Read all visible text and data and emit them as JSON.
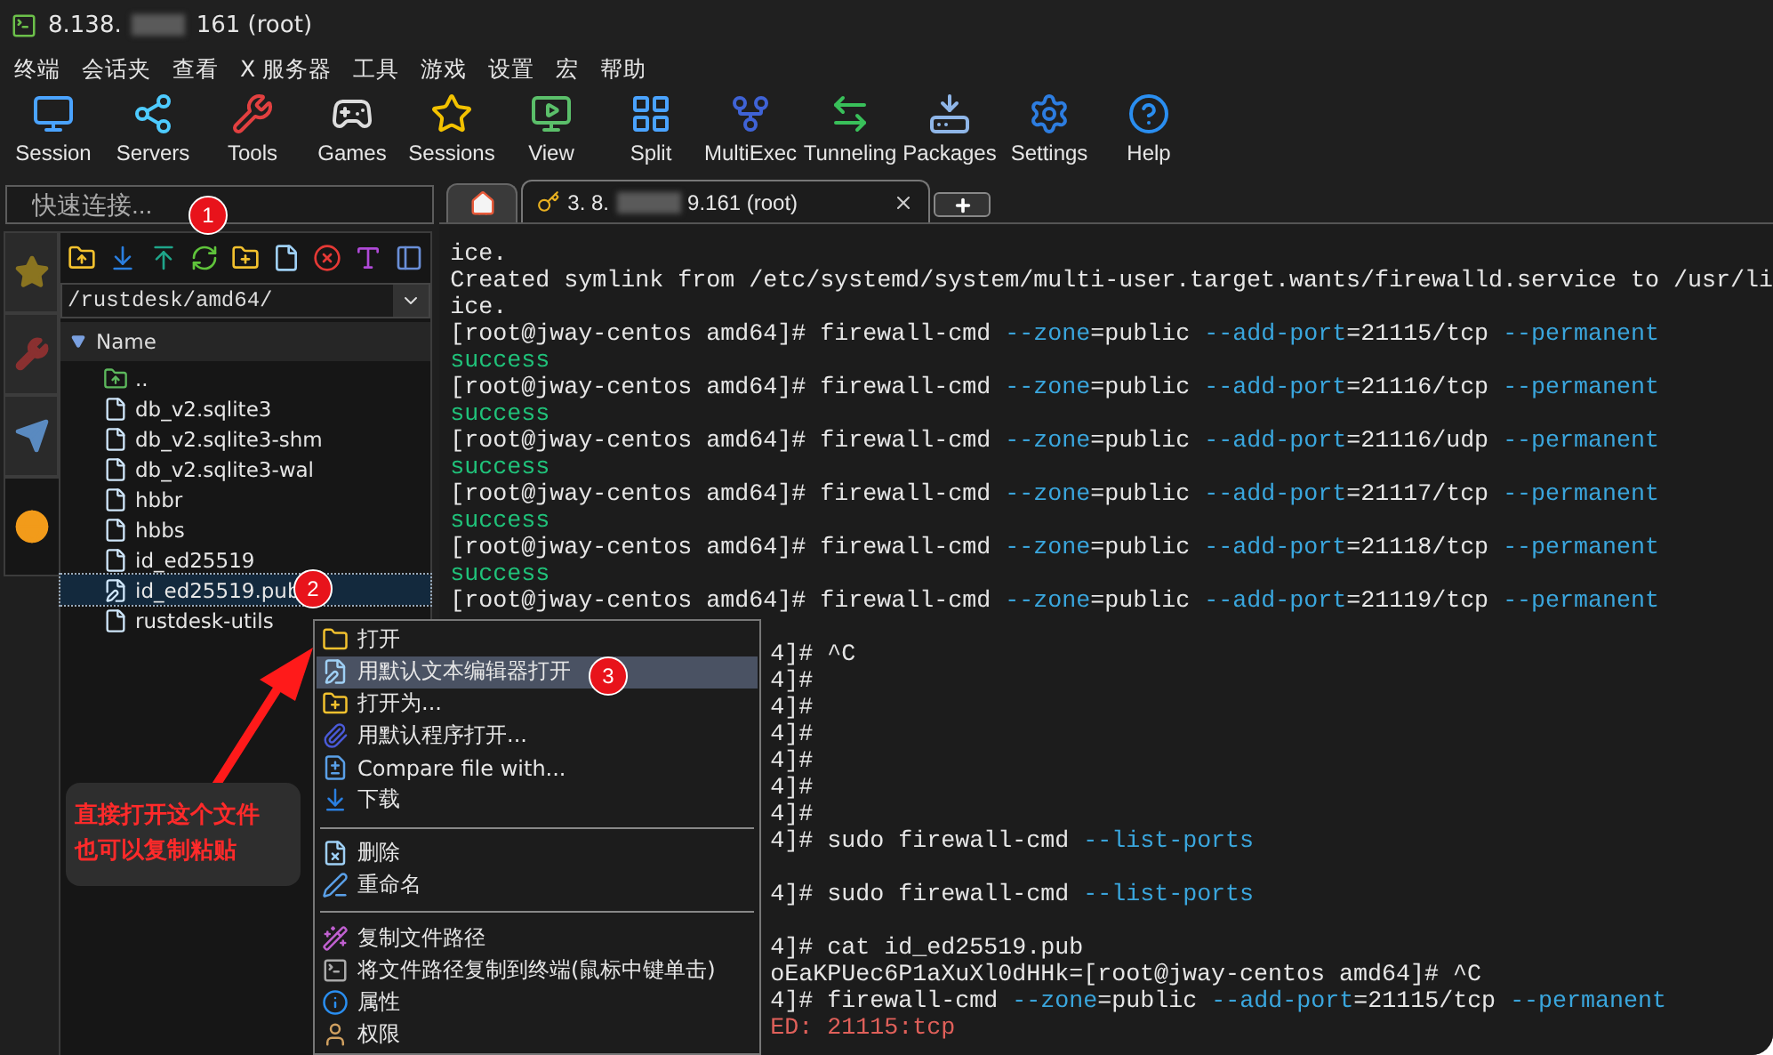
{
  "window": {
    "title_parts": [
      "8.138.",
      "161 (root)"
    ]
  },
  "menu": [
    "终端",
    "会话夹",
    "查看",
    "X 服务器",
    "工具",
    "游戏",
    "设置",
    "宏",
    "帮助"
  ],
  "toolbar": [
    "Session",
    "Servers",
    "Tools",
    "Games",
    "Sessions",
    "View",
    "Split",
    "MultiExec",
    "Tunneling",
    "Packages",
    "Settings",
    "Help"
  ],
  "quick_connect": {
    "placeholder": "快速连接..."
  },
  "side_tabs": [
    {
      "selected": false
    },
    {
      "selected": false
    },
    {
      "selected": false
    },
    {
      "selected": true
    }
  ],
  "file_browser": {
    "path": "/rustdesk/amd64/",
    "column": "Name",
    "files": [
      {
        "name": "..",
        "kind": "parent",
        "selected": false
      },
      {
        "name": "db_v2.sqlite3",
        "kind": "file",
        "selected": false
      },
      {
        "name": "db_v2.sqlite3-shm",
        "kind": "file",
        "selected": false
      },
      {
        "name": "db_v2.sqlite3-wal",
        "kind": "file",
        "selected": false
      },
      {
        "name": "hbbr",
        "kind": "file",
        "selected": false
      },
      {
        "name": "hbbs",
        "kind": "file",
        "selected": false
      },
      {
        "name": "id_ed25519",
        "kind": "file",
        "selected": false
      },
      {
        "name": "id_ed25519.pub",
        "kind": "text",
        "selected": true
      },
      {
        "name": "rustdesk-utils",
        "kind": "file",
        "selected": false
      }
    ]
  },
  "session_tab": {
    "label_parts": [
      "3. 8.",
      "9.161 (root)"
    ]
  },
  "terminal": [
    {
      "kind": "full",
      "segments": [
        {
          "text": "ice.",
          "kind": "plain"
        }
      ]
    },
    {
      "kind": "full",
      "segments": [
        {
          "text": "Created symlink from /etc/systemd/system/multi-user.target.wants/firewalld.service to /usr/li",
          "kind": "plain"
        }
      ]
    },
    {
      "kind": "full",
      "segments": [
        {
          "text": "ice.",
          "kind": "plain"
        }
      ]
    },
    {
      "kind": "full",
      "segments": [
        {
          "text": "[root@jway-centos amd64]# firewall-cmd ",
          "kind": "plain"
        },
        {
          "text": "--zone",
          "kind": "option"
        },
        {
          "text": "=public ",
          "kind": "plain"
        },
        {
          "text": "--add-port",
          "kind": "option"
        },
        {
          "text": "=21115/tcp ",
          "kind": "plain"
        },
        {
          "text": "--permanent",
          "kind": "option"
        }
      ]
    },
    {
      "kind": "full",
      "segments": [
        {
          "text": "success",
          "kind": "success"
        }
      ]
    },
    {
      "kind": "full",
      "segments": [
        {
          "text": "[root@jway-centos amd64]# firewall-cmd ",
          "kind": "plain"
        },
        {
          "text": "--zone",
          "kind": "option"
        },
        {
          "text": "=public ",
          "kind": "plain"
        },
        {
          "text": "--add-port",
          "kind": "option"
        },
        {
          "text": "=21116/tcp ",
          "kind": "plain"
        },
        {
          "text": "--permanent",
          "kind": "option"
        }
      ]
    },
    {
      "kind": "full",
      "segments": [
        {
          "text": "success",
          "kind": "success"
        }
      ]
    },
    {
      "kind": "full",
      "segments": [
        {
          "text": "[root@jway-centos amd64]# firewall-cmd ",
          "kind": "plain"
        },
        {
          "text": "--zone",
          "kind": "option"
        },
        {
          "text": "=public ",
          "kind": "plain"
        },
        {
          "text": "--add-port",
          "kind": "option"
        },
        {
          "text": "=21116/udp ",
          "kind": "plain"
        },
        {
          "text": "--permanent",
          "kind": "option"
        }
      ]
    },
    {
      "kind": "full",
      "segments": [
        {
          "text": "success",
          "kind": "success"
        }
      ]
    },
    {
      "kind": "full",
      "segments": [
        {
          "text": "[root@jway-centos amd64]# firewall-cmd ",
          "kind": "plain"
        },
        {
          "text": "--zone",
          "kind": "option"
        },
        {
          "text": "=public ",
          "kind": "plain"
        },
        {
          "text": "--add-port",
          "kind": "option"
        },
        {
          "text": "=21117/tcp ",
          "kind": "plain"
        },
        {
          "text": "--permanent",
          "kind": "option"
        }
      ]
    },
    {
      "kind": "full",
      "segments": [
        {
          "text": "success",
          "kind": "success"
        }
      ]
    },
    {
      "kind": "full",
      "segments": [
        {
          "text": "[root@jway-centos amd64]# firewall-cmd ",
          "kind": "plain"
        },
        {
          "text": "--zone",
          "kind": "option"
        },
        {
          "text": "=public ",
          "kind": "plain"
        },
        {
          "text": "--add-port",
          "kind": "option"
        },
        {
          "text": "=21118/tcp ",
          "kind": "plain"
        },
        {
          "text": "--permanent",
          "kind": "option"
        }
      ]
    },
    {
      "kind": "full",
      "segments": [
        {
          "text": "success",
          "kind": "success"
        }
      ]
    },
    {
      "kind": "full",
      "segments": [
        {
          "text": "[root@jway-centos amd64]# firewall-cmd ",
          "kind": "plain"
        },
        {
          "text": "--zone",
          "kind": "option"
        },
        {
          "text": "=public ",
          "kind": "plain"
        },
        {
          "text": "--add-port",
          "kind": "option"
        },
        {
          "text": "=21119/tcp ",
          "kind": "plain"
        },
        {
          "text": "--permanent",
          "kind": "option"
        }
      ]
    },
    {
      "kind": "blank"
    },
    {
      "kind": "covered",
      "segments": [
        {
          "text": "4]# ^C",
          "kind": "plain"
        }
      ]
    },
    {
      "kind": "covered",
      "segments": [
        {
          "text": "4]#",
          "kind": "plain"
        }
      ]
    },
    {
      "kind": "covered",
      "segments": [
        {
          "text": "4]#",
          "kind": "plain"
        }
      ]
    },
    {
      "kind": "covered",
      "segments": [
        {
          "text": "4]#",
          "kind": "plain"
        }
      ]
    },
    {
      "kind": "covered",
      "segments": [
        {
          "text": "4]#",
          "kind": "plain"
        }
      ]
    },
    {
      "kind": "covered",
      "segments": [
        {
          "text": "4]#",
          "kind": "plain"
        }
      ]
    },
    {
      "kind": "covered",
      "segments": [
        {
          "text": "4]#",
          "kind": "plain"
        }
      ]
    },
    {
      "kind": "covered",
      "segments": [
        {
          "text": "4]# sudo firewall-cmd ",
          "kind": "plain"
        },
        {
          "text": "--list-ports",
          "kind": "option"
        }
      ]
    },
    {
      "kind": "blank"
    },
    {
      "kind": "covered",
      "segments": [
        {
          "text": "4]# sudo firewall-cmd ",
          "kind": "plain"
        },
        {
          "text": "--list-ports",
          "kind": "option"
        }
      ]
    },
    {
      "kind": "blank"
    },
    {
      "kind": "covered",
      "segments": [
        {
          "text": "4]# cat id_ed25519.pub",
          "kind": "plain"
        }
      ]
    },
    {
      "kind": "covered",
      "segments": [
        {
          "text": "oEaKPUec6P1aXuXl0dHHk=[root@jway-centos amd64]# ^C",
          "kind": "plain"
        }
      ]
    },
    {
      "kind": "covered",
      "segments": [
        {
          "text": "4]# firewall-cmd ",
          "kind": "plain"
        },
        {
          "text": "--zone",
          "kind": "option"
        },
        {
          "text": "=public ",
          "kind": "plain"
        },
        {
          "text": "--add-port",
          "kind": "option"
        },
        {
          "text": "=21115/tcp ",
          "kind": "plain"
        },
        {
          "text": "--permanent",
          "kind": "option"
        }
      ]
    },
    {
      "kind": "covered",
      "segments": [
        {
          "text": "ED: 21115:tcp",
          "kind": "error"
        }
      ]
    }
  ],
  "context_menu": [
    {
      "kind": "item",
      "label": "打开",
      "selected": false
    },
    {
      "kind": "item",
      "label": "用默认文本编辑器打开",
      "selected": true
    },
    {
      "kind": "item",
      "label": "打开为...",
      "selected": false
    },
    {
      "kind": "item",
      "label": "用默认程序打开...",
      "selected": false
    },
    {
      "kind": "item",
      "label": "Compare file with...",
      "selected": false
    },
    {
      "kind": "item",
      "label": "下载",
      "selected": false
    },
    {
      "kind": "separator"
    },
    {
      "kind": "item",
      "label": "删除",
      "selected": false
    },
    {
      "kind": "item",
      "label": "重命名",
      "selected": false
    },
    {
      "kind": "separator"
    },
    {
      "kind": "item",
      "label": "复制文件路径",
      "selected": false
    },
    {
      "kind": "item",
      "label": "将文件路径复制到终端(鼠标中键单击)",
      "selected": false
    },
    {
      "kind": "item",
      "label": "属性",
      "selected": false
    },
    {
      "kind": "item",
      "label": "权限",
      "selected": false
    }
  ],
  "annotations": {
    "markers": [
      "1",
      "2",
      "3"
    ],
    "note_lines": [
      "直接打开这个文件",
      "也可以复制粘贴"
    ]
  }
}
